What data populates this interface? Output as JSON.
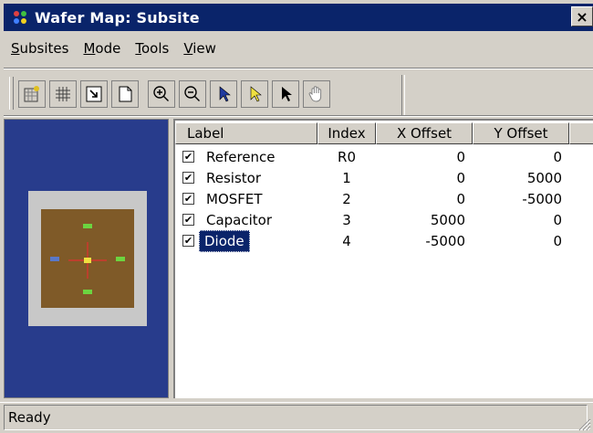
{
  "window": {
    "title": "Wafer Map: Subsite",
    "close_label": "×"
  },
  "menu": [
    {
      "key": "S",
      "rest": "ubsites"
    },
    {
      "key": "M",
      "rest": "ode"
    },
    {
      "key": "T",
      "rest": "ools"
    },
    {
      "key": "V",
      "rest": "iew"
    }
  ],
  "toolbar": {
    "buttons": [
      "add-subsite-icon",
      "grid-icon",
      "import-icon",
      "new-document-icon",
      "zoom-in-icon",
      "zoom-out-icon",
      "select-arrow-icon",
      "yellow-arrow-icon",
      "black-arrow-icon",
      "hand-pan-icon"
    ]
  },
  "columns": {
    "label": "Label",
    "index": "Index",
    "x_offset": "X Offset",
    "y_offset": "Y Offset"
  },
  "rows": [
    {
      "checked": true,
      "label": "Reference",
      "index": "R0",
      "x": "0",
      "y": "0",
      "selected": false
    },
    {
      "checked": true,
      "label": "Resistor",
      "index": "1",
      "x": "0",
      "y": "5000",
      "selected": false
    },
    {
      "checked": true,
      "label": "MOSFET",
      "index": "2",
      "x": "0",
      "y": "-5000",
      "selected": false
    },
    {
      "checked": true,
      "label": "Capacitor",
      "index": "3",
      "x": "5000",
      "y": "0",
      "selected": false
    },
    {
      "checked": true,
      "label": "Diode",
      "index": "4",
      "x": "-5000",
      "y": "0",
      "selected": true
    }
  ],
  "status": {
    "text": "Ready"
  },
  "colors": {
    "titlebar": "#0a246a",
    "selection": "#0a246a",
    "preview_bg": "#283c8c",
    "die": "#7f5a28"
  }
}
